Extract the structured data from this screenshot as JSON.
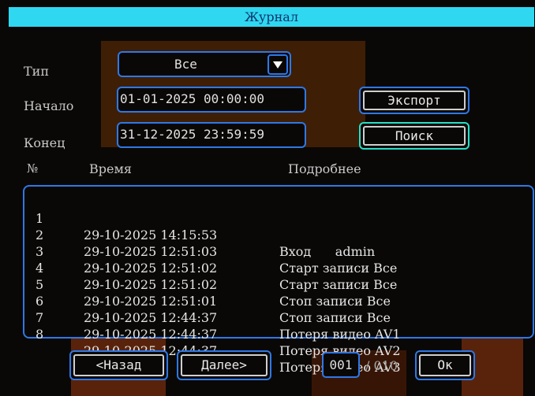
{
  "window": {
    "title": "Журнал"
  },
  "filters": {
    "type_label": "Тип",
    "type_value": "Все",
    "start_label": "Начало",
    "start_value": "01-01-2025 00:00:00",
    "end_label": "Конец",
    "end_value": "31-12-2025 23:59:59",
    "export_button": "Экспорт",
    "search_button": "Поиск"
  },
  "table": {
    "headers": {
      "num": "№",
      "time": "Время",
      "detail": "Подробнее"
    },
    "rows": [
      {
        "num": "1",
        "time": "29-10-2025 14:15:53",
        "detail": "Вход      admin"
      },
      {
        "num": "2",
        "time": "29-10-2025 12:51:03",
        "detail": "Старт записи Все"
      },
      {
        "num": "3",
        "time": "29-10-2025 12:51:02",
        "detail": "Старт записи Все"
      },
      {
        "num": "4",
        "time": "29-10-2025 12:51:02",
        "detail": "Стоп записи Все"
      },
      {
        "num": "5",
        "time": "29-10-2025 12:51:01",
        "detail": "Стоп записи Все"
      },
      {
        "num": "6",
        "time": "29-10-2025 12:44:37",
        "detail": "Потеря видео AV1"
      },
      {
        "num": "7",
        "time": "29-10-2025 12:44:37",
        "detail": "Потеря видео AV2"
      },
      {
        "num": "8",
        "time": "29-10-2025 12:44:37",
        "detail": "Потеря видео AV3"
      }
    ]
  },
  "pager": {
    "prev_button": "<Назад",
    "next_button": "Далее>",
    "current_page": "001",
    "total_pages": "/ 010",
    "ok_button": "Ок"
  },
  "colors": {
    "title_bar": "#2fd8f0",
    "border_accent": "#2f78e6",
    "focus_border": "#25e0c8"
  }
}
